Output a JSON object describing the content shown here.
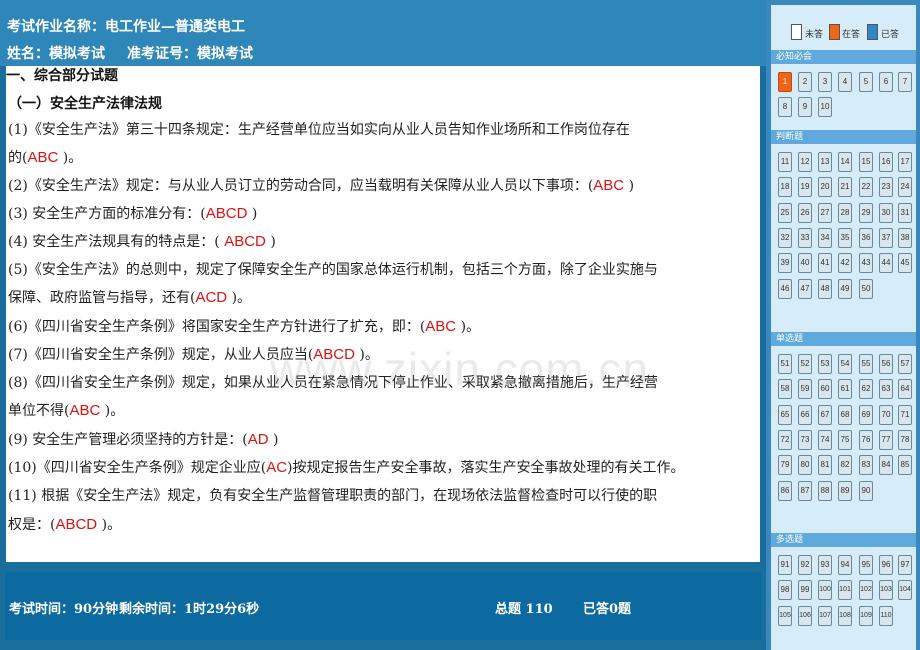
{
  "header": {
    "line1": "考试作业名称：电工作业—普通类电工",
    "name": "姓名：模拟考试",
    "ticket": "准考证号：模拟考试"
  },
  "content": {
    "section_title": "一、综合部分试题",
    "subsection_title": "（一）安全生产法律法规",
    "questions": [
      {
        "lines": [
          {
            "text": "(1)《安全生产法》第三十四条规定：生产经营单位应当如实向从业人员告知作业场所和工作岗位存在",
            "pre": "",
            "ans": "",
            "post": ""
          },
          {
            "text": "",
            "pre": "的(",
            "ans": "ABC",
            "post": " )。"
          }
        ]
      },
      {
        "lines": [
          {
            "text": "",
            "pre": "(2)《安全生产法》规定：与从业人员订立的劳动合同，应当载明有关保障从业人员以下事项：(",
            "ans": "ABC",
            "post": " )"
          }
        ]
      },
      {
        "lines": [
          {
            "text": "",
            "pre": "(3) 安全生产方面的标准分有：(",
            "ans": "ABCD",
            "post": " )"
          }
        ]
      },
      {
        "lines": [
          {
            "text": "",
            "pre": "(4) 安全生产法规具有的特点是：( ",
            "ans": "ABCD",
            "post": " )"
          }
        ]
      },
      {
        "lines": [
          {
            "text": "(5)《安全生产法》的总则中，规定了保障安全生产的国家总体运行机制，包括三个方面，除了企业实施与",
            "pre": "",
            "ans": "",
            "post": ""
          },
          {
            "text": "",
            "pre": "保障、政府监管与指导，还有(",
            "ans": "ACD",
            "post": " )。"
          }
        ]
      },
      {
        "lines": [
          {
            "text": "",
            "pre": "(6)《四川省安全生产条例》将国家安全生产方针进行了扩充，即：(",
            "ans": "ABC",
            "post": " )。"
          }
        ]
      },
      {
        "lines": [
          {
            "text": "",
            "pre": "(7)《四川省安全生产条例》规定，从业人员应当(",
            "ans": "ABCD",
            "post": " )。"
          }
        ]
      },
      {
        "lines": [
          {
            "text": "(8)《四川省安全生产条例》规定，如果从业人员在紧急情况下停止作业、采取紧急撤离措施后，生产经营",
            "pre": "",
            "ans": "",
            "post": ""
          },
          {
            "text": "",
            "pre": "单位不得(",
            "ans": "ABC",
            "post": " )。"
          }
        ]
      },
      {
        "lines": [
          {
            "text": "",
            "pre": "(9) 安全生产管理必须坚持的方针是：(",
            "ans": "AD",
            "post": " )"
          }
        ]
      },
      {
        "lines": [
          {
            "text": "",
            "pre": "(10)《四川省安全生产条例》规定企业应(",
            "ans": "AC",
            "post": ")按规定报告生产安全事故，落实生产安全事故处理的有关工作。"
          }
        ]
      },
      {
        "lines": [
          {
            "text": "(11) 根据《安全生产法》规定，负有安全生产监督管理职责的部门，在现场依法监督检查时可以行使的职",
            "pre": "",
            "ans": "",
            "post": ""
          },
          {
            "text": "",
            "pre": "权是：(",
            "ans": "ABCD",
            "post": " )。"
          }
        ]
      }
    ],
    "watermark": "www.zixin.com.cn"
  },
  "footer": {
    "exam_time": "考试时间：90分钟",
    "remaining_time": "剩余时间：1时29分6秒",
    "total": "总题 110",
    "answered": "已答0题"
  },
  "legend": {
    "unanswered": "未答",
    "current": "在答",
    "answered": "已答",
    "colors": {
      "unanswered": "#ffffff",
      "current": "#f06418",
      "answered": "#2f86c8"
    }
  },
  "sections": [
    {
      "title": "必知必会",
      "start": 1,
      "end": 10
    },
    {
      "title": "判断题",
      "start": 11,
      "end": 50
    },
    {
      "title": "单选题",
      "start": 51,
      "end": 90
    },
    {
      "title": "多选题",
      "start": 91,
      "end": 110
    }
  ],
  "current_question": 1
}
